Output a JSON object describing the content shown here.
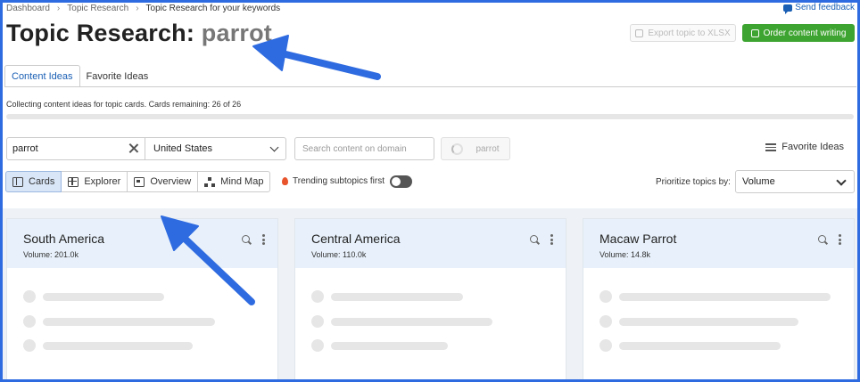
{
  "breadcrumb": [
    "Dashboard",
    "Topic Research",
    "Topic Research for your keywords"
  ],
  "feedback_label": "Send feedback",
  "title": {
    "prefix": "Topic Research:",
    "keyword": "parrot"
  },
  "buttons": {
    "export": "Export topic to XLSX",
    "order": "Order content writing"
  },
  "tabs": [
    "Content Ideas",
    "Favorite Ideas"
  ],
  "status_text": "Collecting content ideas for topic cards. Cards remaining: 26 of 26",
  "progress": 0,
  "search": {
    "value": "parrot"
  },
  "country": "United States",
  "domain_search": {
    "placeholder": "Search content on domain"
  },
  "domain_button": "parrot",
  "favorite_ideas_link": "Favorite Ideas",
  "views": [
    "Cards",
    "Explorer",
    "Overview",
    "Mind Map"
  ],
  "trending_label": "Trending subtopics first",
  "prioritize_label": "Prioritize topics by:",
  "prioritize_value": "Volume",
  "cards": [
    {
      "title": "South America",
      "volume": "Volume:  201.0k"
    },
    {
      "title": "Central America",
      "volume": "Volume:  110.0k"
    },
    {
      "title": "Macaw Parrot",
      "volume": "Volume:  14.8k"
    }
  ],
  "colors": {
    "accent": "#1a5fb4",
    "primary_button": "#3ea431",
    "annotation_arrow": "#2f6be0",
    "card_header": "#e8f1fb"
  },
  "icons": {
    "feedback": "speech-bubble-icon",
    "export": "export-icon",
    "order": "edit-icon",
    "clear": "close-icon",
    "favorite": "list-icon",
    "trending": "flame-icon",
    "card_search": "search-icon",
    "card_menu": "more-vertical-icon"
  }
}
